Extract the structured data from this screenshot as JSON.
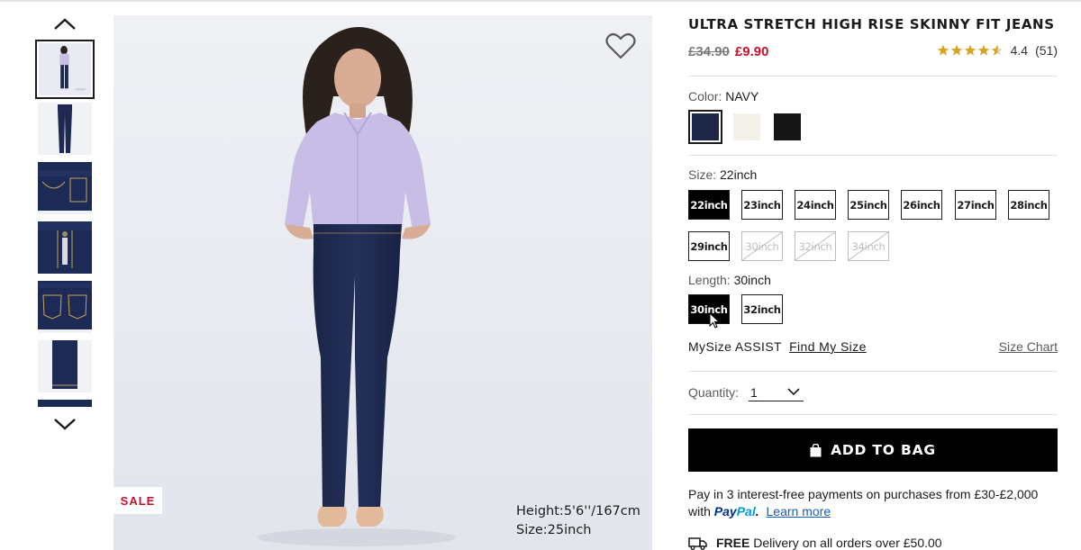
{
  "thumbnails": [
    {
      "name": "model-full-body",
      "selected": true
    },
    {
      "name": "jeans-front"
    },
    {
      "name": "waistband-detail"
    },
    {
      "name": "zip-fly-detail"
    },
    {
      "name": "back-pockets-detail"
    },
    {
      "name": "hem-detail"
    }
  ],
  "icons": {
    "up": "chevron-up-icon",
    "down": "chevron-down-icon",
    "wishlist": "heart-icon",
    "bag": "shopping-bag-icon",
    "truck": "delivery-truck-icon"
  },
  "main_image": {
    "badge": "SALE",
    "model_height": "Height:5'6''/167cm",
    "model_size": "Size:25inch"
  },
  "product": {
    "title": "ULTRA STRETCH HIGH RISE SKINNY FIT JEANS",
    "price_original": "£34.90",
    "price_sale": "£9.90",
    "rating_value": 4.4,
    "rating_text": "4.4",
    "review_count": "(51)"
  },
  "color": {
    "label": "Color:",
    "selected": "NAVY",
    "swatches": [
      {
        "name": "navy",
        "hex": "#1e2647",
        "selected": true
      },
      {
        "name": "off-white",
        "hex": "#f3f1ea"
      },
      {
        "name": "black",
        "hex": "#161616"
      }
    ]
  },
  "size": {
    "label": "Size:",
    "selected": "22inch",
    "options": [
      {
        "label": "22inch",
        "state": "selected"
      },
      {
        "label": "23inch",
        "state": "available"
      },
      {
        "label": "24inch",
        "state": "available"
      },
      {
        "label": "25inch",
        "state": "available"
      },
      {
        "label": "26inch",
        "state": "available"
      },
      {
        "label": "27inch",
        "state": "available"
      },
      {
        "label": "28inch",
        "state": "available"
      },
      {
        "label": "29inch",
        "state": "available"
      },
      {
        "label": "30inch",
        "state": "unavailable"
      },
      {
        "label": "32inch",
        "state": "unavailable"
      },
      {
        "label": "34inch",
        "state": "unavailable"
      }
    ]
  },
  "length": {
    "label": "Length:",
    "selected": "30inch",
    "options": [
      {
        "label": "30inch",
        "state": "selected"
      },
      {
        "label": "32inch",
        "state": "available"
      }
    ]
  },
  "mysize": {
    "label": "MySize ASSIST",
    "link": "Find My Size",
    "size_chart": "Size Chart"
  },
  "quantity": {
    "label": "Quantity:",
    "value": "1"
  },
  "cta": {
    "add_to_bag": "ADD TO BAG"
  },
  "payment": {
    "text": "Pay in 3 interest-free payments on purchases from £30-£2,000 with",
    "brand_pay": "Pay",
    "brand_pal": "Pal",
    "link": "Learn more"
  },
  "delivery": {
    "bold": "FREE",
    "text": "Delivery on all orders over £50.00"
  },
  "colors": {
    "sale_red": "#c8102e",
    "star_gold": "#d9a520",
    "paypal_dark": "#003087",
    "paypal_light": "#009cde",
    "link_blue": "#1a5bb8"
  }
}
